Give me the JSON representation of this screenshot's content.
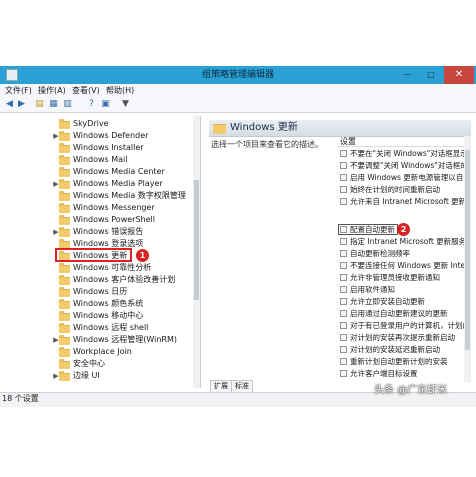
{
  "window": {
    "title": "组策略管理编辑器",
    "controls": {
      "minimize": "—",
      "maximize": "□",
      "close": "✕"
    }
  },
  "menu": [
    {
      "label": "文件(F)"
    },
    {
      "label": "操作(A)"
    },
    {
      "label": "查看(V)"
    },
    {
      "label": "帮助(H)"
    }
  ],
  "toolbar": {
    "icons": [
      "back-icon",
      "forward-icon",
      "up-folder-icon",
      "show-hide-tree-icon",
      "export-list-icon",
      "help-icon",
      "properties-icon",
      "filter-icon"
    ]
  },
  "tree": {
    "items": [
      {
        "label": "SkyDrive",
        "expandable": false
      },
      {
        "label": "Windows Defender",
        "expandable": true
      },
      {
        "label": "Windows Installer",
        "expandable": false
      },
      {
        "label": "Windows Mail",
        "expandable": false
      },
      {
        "label": "Windows Media Center",
        "expandable": false
      },
      {
        "label": "Windows Media Player",
        "expandable": true
      },
      {
        "label": "Windows Media 数字权限管理",
        "expandable": false
      },
      {
        "label": "Windows Messenger",
        "expandable": false
      },
      {
        "label": "Windows PowerShell",
        "expandable": false
      },
      {
        "label": "Windows 错误报告",
        "expandable": true
      },
      {
        "label": "Windows 登录选项",
        "expandable": false
      },
      {
        "label": "Windows 更新",
        "expandable": false,
        "selected": true
      },
      {
        "label": "Windows 可靠性分析",
        "expandable": false
      },
      {
        "label": "Windows 客户体验改善计划",
        "expandable": false
      },
      {
        "label": "Windows 日历",
        "expandable": false
      },
      {
        "label": "Windows 颜色系统",
        "expandable": false
      },
      {
        "label": "Windows 移动中心",
        "expandable": false
      },
      {
        "label": "Windows 远程 shell",
        "expandable": false
      },
      {
        "label": "Windows 远程管理(WinRM)",
        "expandable": true
      },
      {
        "label": "Workplace Join",
        "expandable": false
      },
      {
        "label": "安全中心",
        "expandable": false
      },
      {
        "label": "边缘 UI",
        "expandable": false
      }
    ]
  },
  "markers": {
    "first": "1",
    "second": "2"
  },
  "details": {
    "title": "Windows 更新",
    "description": "选择一个项目来查看它的描述。",
    "column_header": "设置",
    "settings": [
      "不要在\"关闭 Windows\"对话框显示",
      "不要调整\"关闭 Windows\"对话框的",
      "启用 Windows 更新电源管理以自动",
      "始终在计划的时间重新启动",
      "配置自动更新",
      "指定 Intranet Microsoft 更新服务",
      "自动更新检测频率",
      "不要连接任何 Windows 更新 Inter",
      "允许非管理员接收更新通知",
      "启用软件通知",
      "允许立即安装自动更新",
      "启用通过自动更新建议的更新",
      "对于有已登录用户的计算机，计划的",
      "对计划的安装再次提示重新启动",
      "对计划的安装延迟重新启动",
      "重新计划自动更新计划的安装",
      "允许客户端目标设置",
      "允许来自 Intranet Microsoft 更新"
    ],
    "selected_setting_index": 4
  },
  "tabs": [
    {
      "label": "扩展"
    },
    {
      "label": "标准"
    }
  ],
  "status": {
    "text": "18 个设置"
  },
  "watermark": {
    "text": "头条 @广东虾米"
  }
}
